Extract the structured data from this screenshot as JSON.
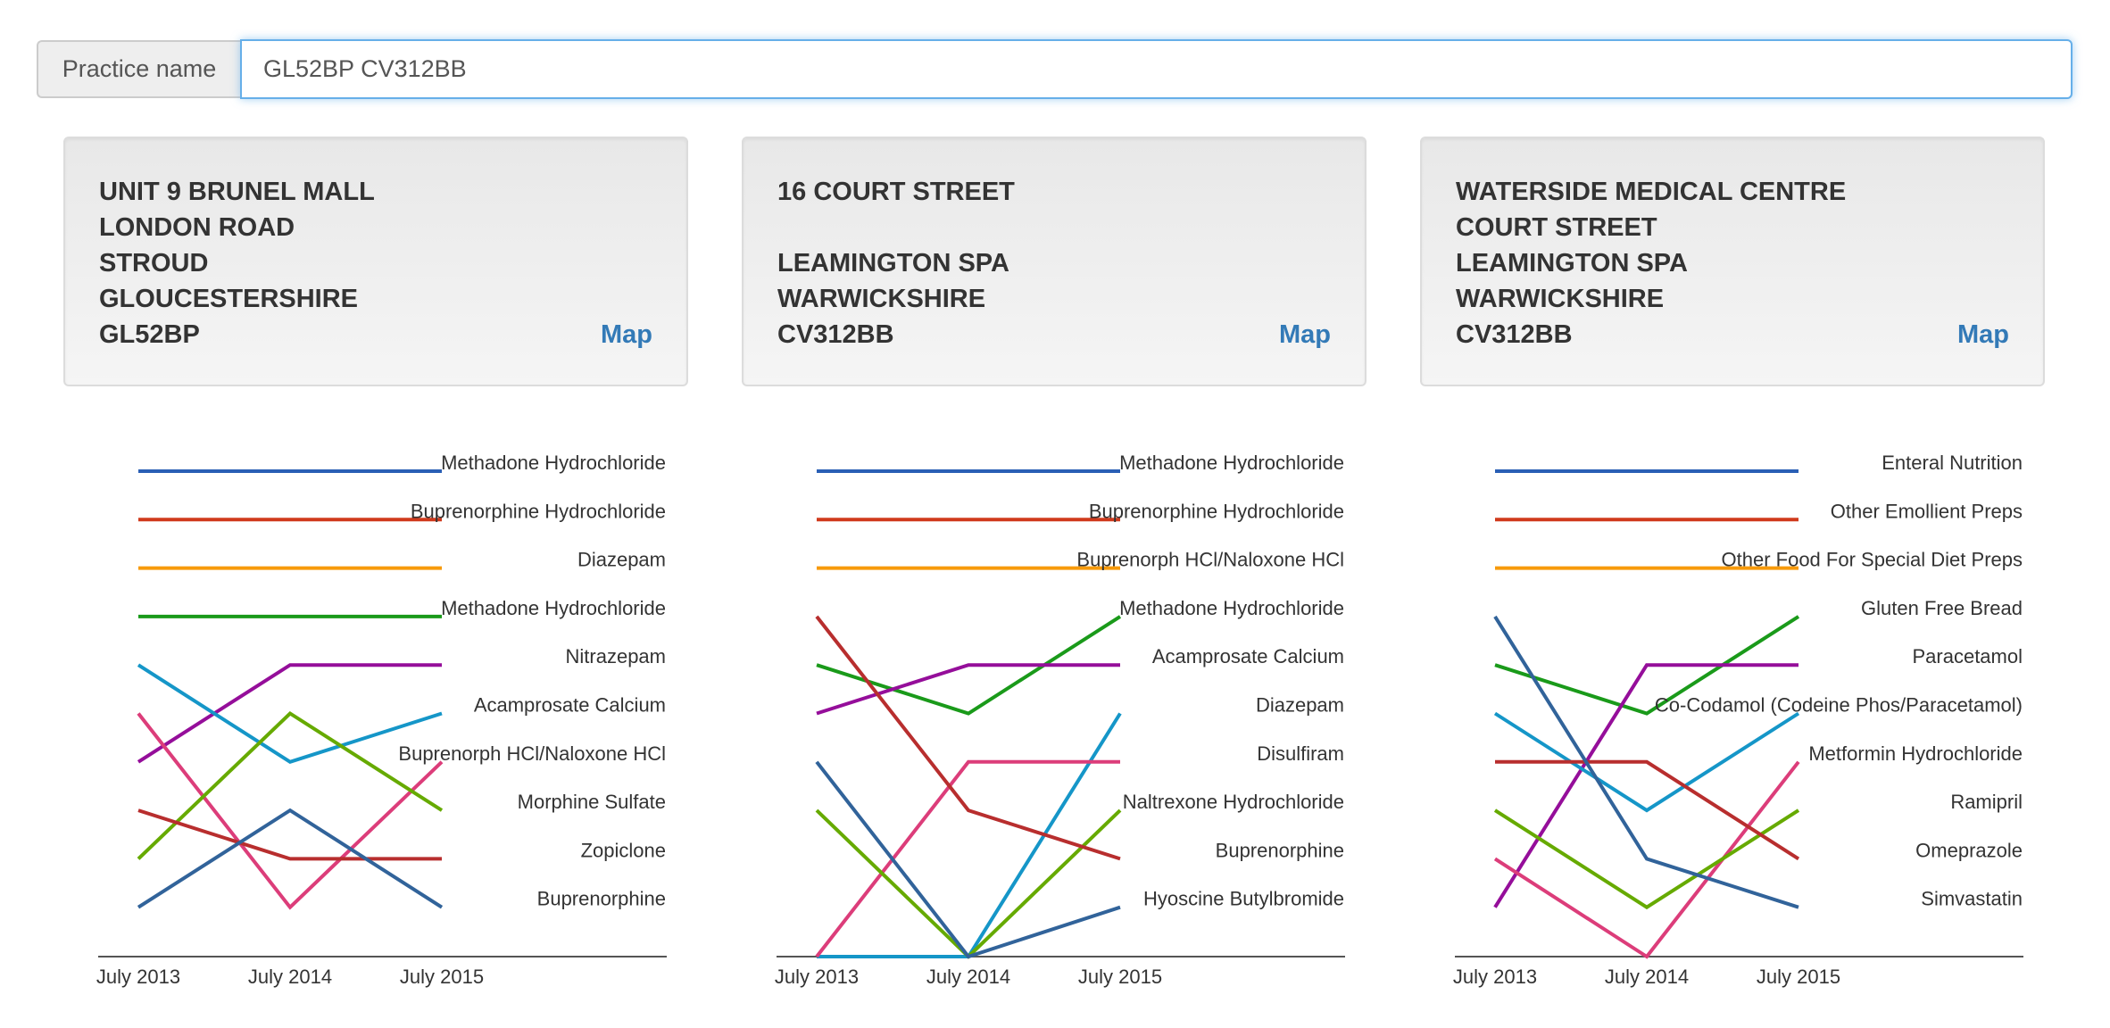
{
  "search": {
    "label": "Practice name",
    "value": "GL52BP CV312BB"
  },
  "practices": [
    {
      "address": [
        "UNIT 9 BRUNEL MALL",
        "LONDON ROAD",
        "STROUD",
        "GLOUCESTERSHIRE",
        "GL52BP"
      ],
      "map_label": "Map"
    },
    {
      "address": [
        "16 COURT STREET",
        "",
        "LEAMINGTON SPA",
        "WARWICKSHIRE",
        "CV312BB"
      ],
      "map_label": "Map"
    },
    {
      "address": [
        "WATERSIDE MEDICAL CENTRE",
        "COURT STREET",
        "LEAMINGTON SPA",
        "WARWICKSHIRE",
        "CV312BB"
      ],
      "map_label": "Map"
    }
  ],
  "chart_data": [
    {
      "type": "line",
      "x": [
        "July 2013",
        "July 2014",
        "July 2015"
      ],
      "ranks": 10,
      "series": [
        {
          "name": "Methadone Hydrochloride",
          "color": "#2a5fb5",
          "ranks": [
            1,
            1,
            1
          ]
        },
        {
          "name": "Buprenorphine Hydrochloride",
          "color": "#d03a1c",
          "ranks": [
            2,
            2,
            2
          ]
        },
        {
          "name": "Diazepam",
          "color": "#f79a0b",
          "ranks": [
            3,
            3,
            3
          ]
        },
        {
          "name": "Methadone Hydrochloride",
          "color": "#1a9a1a",
          "ranks": [
            4,
            4,
            4
          ]
        },
        {
          "name": "Nitrazepam",
          "color": "#950e9a",
          "ranks": [
            7,
            5,
            5
          ]
        },
        {
          "name": "Acamprosate Calcium",
          "color": "#1596c8",
          "ranks": [
            5,
            7,
            6
          ]
        },
        {
          "name": "Buprenorph HCl/Naloxone HCl",
          "color": "#dc3d7a",
          "ranks": [
            6,
            10,
            7
          ]
        },
        {
          "name": "Morphine Sulfate",
          "color": "#66aa00",
          "ranks": [
            9,
            6,
            8
          ]
        },
        {
          "name": "Zopiclone",
          "color": "#b82e2e",
          "ranks": [
            8,
            9,
            9
          ]
        },
        {
          "name": "Buprenorphine",
          "color": "#31639a",
          "ranks": [
            10,
            8,
            10
          ]
        }
      ]
    },
    {
      "type": "line",
      "x": [
        "July 2013",
        "July 2014",
        "July 2015"
      ],
      "ranks": 10,
      "series": [
        {
          "name": "Methadone Hydrochloride",
          "color": "#2a5fb5",
          "ranks": [
            1,
            1,
            1
          ]
        },
        {
          "name": "Buprenorphine Hydrochloride",
          "color": "#d03a1c",
          "ranks": [
            2,
            2,
            2
          ]
        },
        {
          "name": "Buprenorph HCl/Naloxone HCl",
          "color": "#f79a0b",
          "ranks": [
            3,
            3,
            3
          ]
        },
        {
          "name": "Methadone Hydrochloride",
          "color": "#1a9a1a",
          "ranks": [
            5,
            6,
            4
          ]
        },
        {
          "name": "Acamprosate Calcium",
          "color": "#950e9a",
          "ranks": [
            6,
            5,
            5
          ]
        },
        {
          "name": "Diazepam",
          "color": "#1596c8",
          "ranks": [
            null,
            null,
            6
          ]
        },
        {
          "name": "Disulfiram",
          "color": "#dc3d7a",
          "ranks": [
            null,
            7,
            7
          ]
        },
        {
          "name": "Naltrexone Hydrochloride",
          "color": "#66aa00",
          "ranks": [
            8,
            null,
            8
          ]
        },
        {
          "name": "Buprenorphine",
          "color": "#b82e2e",
          "ranks": [
            4,
            8,
            9
          ]
        },
        {
          "name": "Hyoscine Butylbromide",
          "color": "#31639a",
          "ranks": [
            7,
            null,
            10
          ]
        }
      ]
    },
    {
      "type": "line",
      "x": [
        "July 2013",
        "July 2014",
        "July 2015"
      ],
      "ranks": 10,
      "series": [
        {
          "name": "Enteral Nutrition",
          "color": "#2a5fb5",
          "ranks": [
            1,
            1,
            1
          ]
        },
        {
          "name": "Other Emollient Preps",
          "color": "#d03a1c",
          "ranks": [
            2,
            2,
            2
          ]
        },
        {
          "name": "Other Food For Special Diet Preps",
          "color": "#f79a0b",
          "ranks": [
            3,
            3,
            3
          ]
        },
        {
          "name": "Gluten Free Bread",
          "color": "#1a9a1a",
          "ranks": [
            5,
            6,
            4
          ]
        },
        {
          "name": "Paracetamol",
          "color": "#950e9a",
          "ranks": [
            10,
            5,
            5
          ]
        },
        {
          "name": "Co-Codamol (Codeine Phos/Paracetamol)",
          "color": "#1596c8",
          "ranks": [
            6,
            8,
            6
          ]
        },
        {
          "name": "Metformin Hydrochloride",
          "color": "#dc3d7a",
          "ranks": [
            9,
            null,
            7
          ]
        },
        {
          "name": "Ramipril",
          "color": "#66aa00",
          "ranks": [
            8,
            10,
            8
          ]
        },
        {
          "name": "Omeprazole",
          "color": "#b82e2e",
          "ranks": [
            7,
            7,
            9
          ]
        },
        {
          "name": "Simvastatin",
          "color": "#31639a",
          "ranks": [
            4,
            9,
            10
          ]
        }
      ]
    }
  ]
}
